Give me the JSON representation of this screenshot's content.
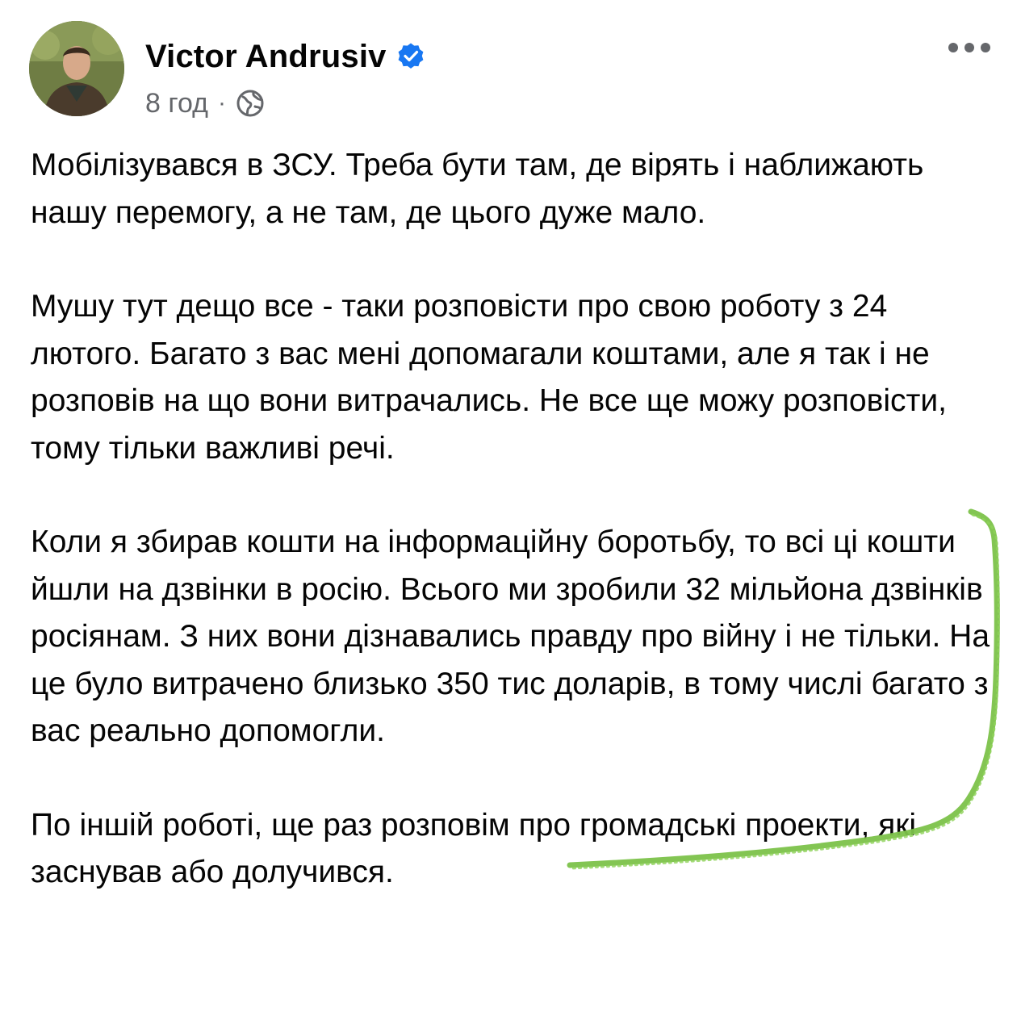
{
  "post": {
    "author": "Victor Andrusiv",
    "time": "8 год",
    "separator": "·",
    "verified_icon": "verified-badge-icon",
    "privacy_icon": "globe-icon",
    "more_icon": "more-options-icon",
    "paragraphs": [
      "Мобілізувався в ЗСУ. Треба бути там, де вірять і наближають нашу перемогу, а не там, де цього дуже мало.",
      "Мушу тут дещо все - таки розповісти про свою роботу з 24 лютого. Багато з вас мені допомагали коштами, але я так і не розповів на що вони витрачались. Не все ще можу розповісти, тому тільки важливі речі.",
      "Коли я збирав кошти на інформаційну боротьбу, то всі ці кошти йшли на дзвінки в росію. Всього ми зробили 32 мільйона дзвінків росіянам. З них вони дізнавались правду про війну і не тільки. На це було витрачено близько 350 тис доларів, в тому числі багато з вас реально допомогли.",
      "По іншій роботі, ще раз розповім про громадські проекти, які заснував або долучився."
    ]
  },
  "colors": {
    "text": "#050505",
    "secondary": "#65676b",
    "verified": "#1877f2",
    "annotation": "#7cc24a"
  }
}
